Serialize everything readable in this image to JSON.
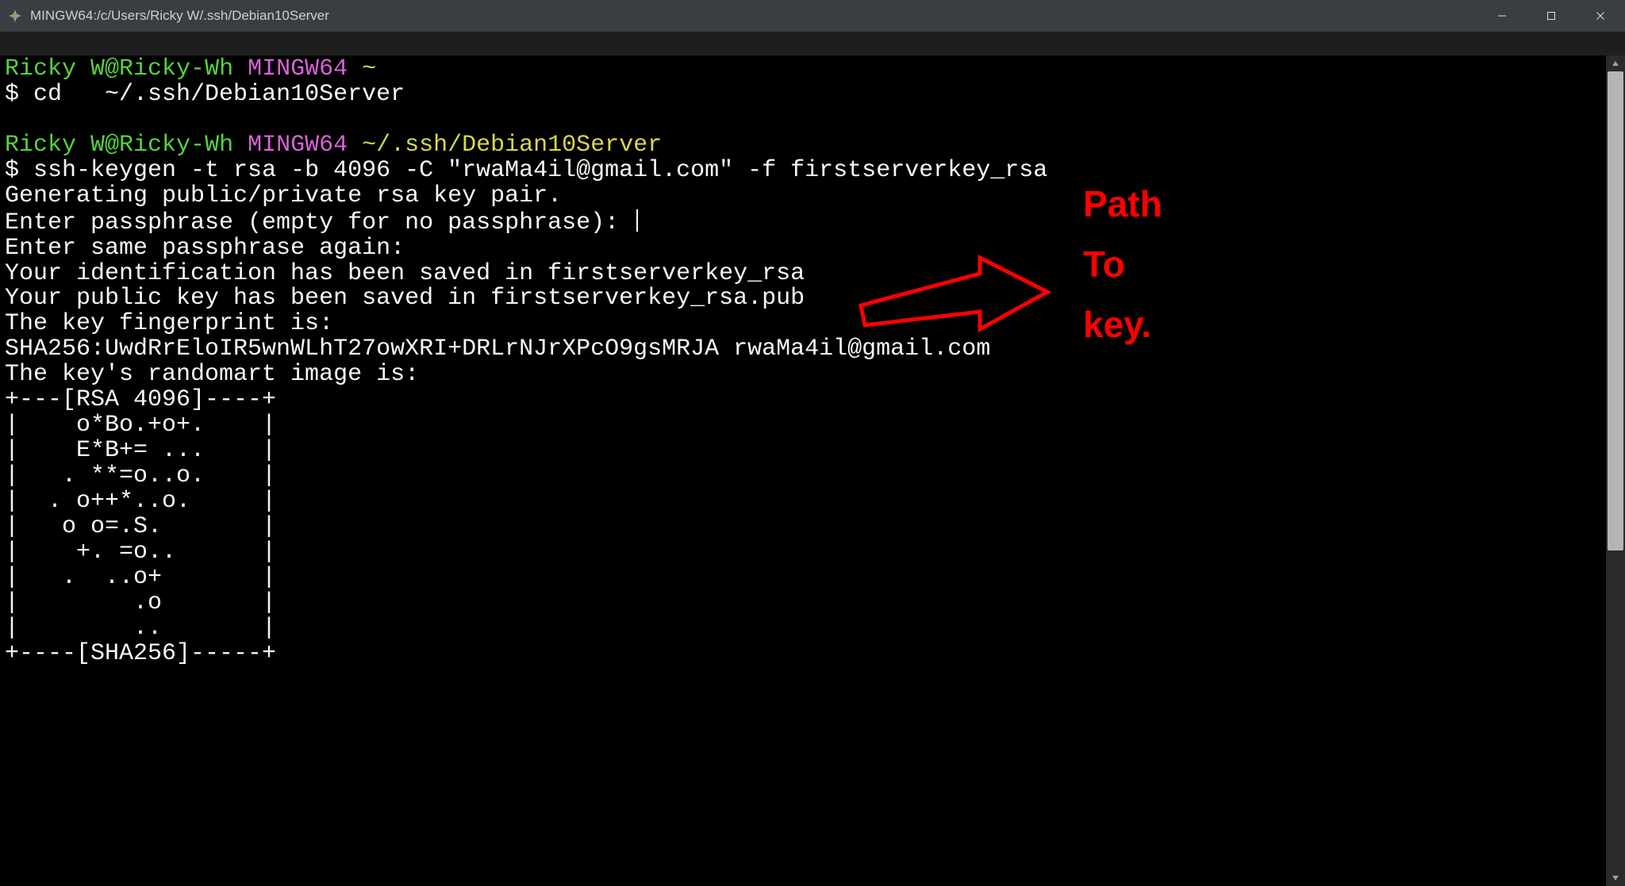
{
  "window": {
    "title": "MINGW64:/c/Users/Ricky W/.ssh/Debian10Server"
  },
  "colors": {
    "green": "#56d23f",
    "magenta": "#d862d8",
    "yellow": "#d8d84e",
    "red": "#ff0000"
  },
  "prompt1": {
    "user": "Ricky W",
    "host": "Ricky-Wh",
    "env": "MINGW64",
    "path": "~"
  },
  "cmd1": "cd   ~/.ssh/Debian10Server",
  "prompt2": {
    "user": "Ricky W",
    "host": "Ricky-Wh",
    "env": "MINGW64",
    "path": "~/.ssh/Debian10Server"
  },
  "cmd2": "ssh-keygen -t rsa -b 4096 -C \"rwaMa4il@gmail.com\" -f firstserverkey_rsa",
  "out": {
    "l1": "Generating public/private rsa key pair.",
    "l2": "Enter passphrase (empty for no passphrase):",
    "l3": "Enter same passphrase again:",
    "l4": "Your identification has been saved in firstserverkey_rsa",
    "l5": "Your public key has been saved in firstserverkey_rsa.pub",
    "l6": "The key fingerprint is:",
    "l7": "SHA256:UwdRrEloIR5wnWLhT27owXRI+DRLrNJrXPcO9gsMRJA rwaMa4il@gmail.com",
    "l8": "The key's randomart image is:"
  },
  "art": {
    "r0": "+---[RSA 4096]----+",
    "r1": "|    o*Bo.+o+.    |",
    "r2": "|    E*B+= ...    |",
    "r3": "|   . **=o..o.    |",
    "r4": "|  . o++*..o.     |",
    "r5": "|   o o=.S.       |",
    "r6": "|    +. =o..      |",
    "r7": "|   .  ..o+       |",
    "r8": "|        .o       |",
    "r9": "|        ..       |",
    "r10": "+----[SHA256]-----+"
  },
  "annotation": {
    "l1": "Path",
    "l2": "To",
    "l3": "key."
  }
}
